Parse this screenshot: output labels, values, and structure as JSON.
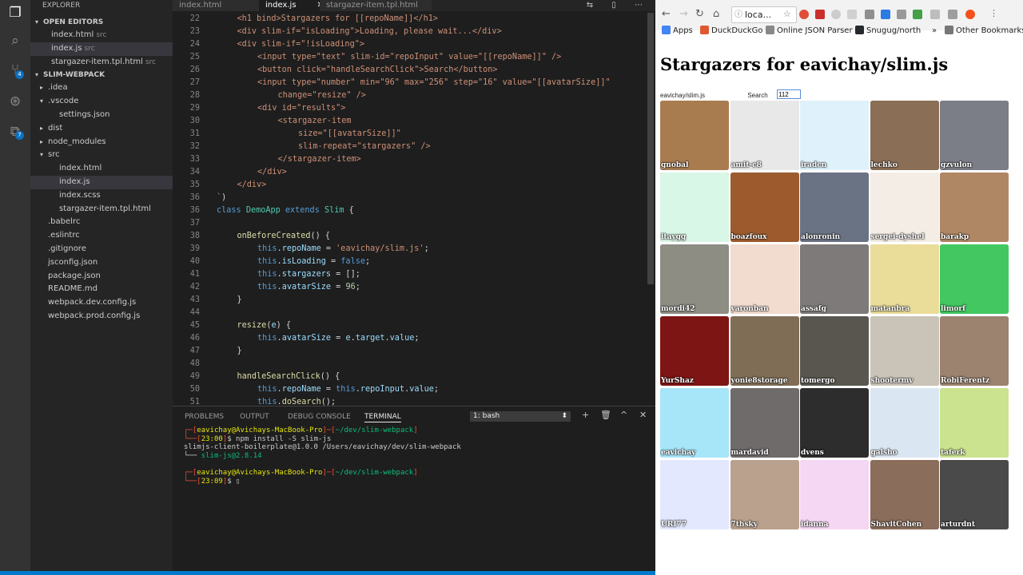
{
  "explorer": {
    "title": "EXPLORER",
    "open_editors_label": "OPEN EDITORS",
    "open_editors": [
      {
        "name": "index.html",
        "folder": "src"
      },
      {
        "name": "index.js",
        "folder": "src"
      },
      {
        "name": "stargazer-item.tpl.html",
        "folder": "src"
      }
    ],
    "project_label": "SLIM-WEBPACK",
    "tree": [
      {
        "name": ".idea",
        "folder": true
      },
      {
        "name": ".vscode",
        "folder": true,
        "open": true
      },
      {
        "name": "settings.json",
        "indent": 2
      },
      {
        "name": "dist",
        "folder": true
      },
      {
        "name": "node_modules",
        "folder": true
      },
      {
        "name": "src",
        "folder": true,
        "open": true
      },
      {
        "name": "index.html",
        "indent": 2
      },
      {
        "name": "index.js",
        "indent": 2,
        "selected": true
      },
      {
        "name": "index.scss",
        "indent": 2
      },
      {
        "name": "stargazer-item.tpl.html",
        "indent": 2
      },
      {
        "name": ".babelrc"
      },
      {
        "name": ".eslintrc"
      },
      {
        "name": ".gitignore"
      },
      {
        "name": "jsconfig.json"
      },
      {
        "name": "package.json"
      },
      {
        "name": "README.md"
      },
      {
        "name": "webpack.dev.config.js"
      },
      {
        "name": "webpack.prod.config.js"
      }
    ]
  },
  "editor": {
    "tabs": [
      "index.html",
      "index.js",
      "stargazer-item.tpl.html"
    ],
    "active_tab": "index.js",
    "close_glyph": "✕",
    "tool_glyphs": "⇆ ▯ ⋯",
    "lines": [
      {
        "n": "22",
        "html": "<span class=\"s\">&lt;h1 bind&gt;Stargazers for [[repoName]]&lt;/h1&gt;</span>",
        "ind": 1
      },
      {
        "n": "23",
        "html": "<span class=\"s\">&lt;div slim-if=\"isLoading\"&gt;Loading, please wait...&lt;/div&gt;</span>",
        "ind": 1
      },
      {
        "n": "24",
        "html": "<span class=\"s\">&lt;div slim-if=\"!isLoading\"&gt;</span>",
        "ind": 1
      },
      {
        "n": "25",
        "html": "<span class=\"s\">&lt;input type=\"text\" slim-id=\"repoInput\" value=\"[[repoName]]\" /&gt;</span>",
        "ind": 2
      },
      {
        "n": "26",
        "html": "<span class=\"s\">&lt;button click=\"handleSearchClick\"&gt;Search&lt;/button&gt;</span>",
        "ind": 2
      },
      {
        "n": "27",
        "html": "<span class=\"s\">&lt;input type=\"number\" min=\"96\" max=\"256\" step=\"16\" value=\"[[avatarSize]]\"</span>",
        "ind": 2
      },
      {
        "n": "28",
        "html": "<span class=\"s\">change=\"resize\" /&gt;</span>",
        "ind": 3
      },
      {
        "n": "29",
        "html": "<span class=\"s\">&lt;div id=\"results\"&gt;</span>",
        "ind": 2
      },
      {
        "n": "30",
        "html": "<span class=\"s\">&lt;stargazer-item</span>",
        "ind": 3
      },
      {
        "n": "31",
        "html": "<span class=\"s\">size=\"[[avatarSize]]\"</span>",
        "ind": 4
      },
      {
        "n": "32",
        "html": "<span class=\"s\">slim-repeat=\"stargazers\" /&gt;</span>",
        "ind": 4
      },
      {
        "n": "33",
        "html": "<span class=\"s\">&lt;/stargazer-item&gt;</span>",
        "ind": 3
      },
      {
        "n": "34",
        "html": "<span class=\"s\">&lt;/div&gt;</span>",
        "ind": 2
      },
      {
        "n": "35",
        "html": "<span class=\"s\">&lt;/div&gt;</span>",
        "ind": 1
      },
      {
        "n": "36",
        "html": "<span class=\"s\">`</span>)",
        "ind": 0
      },
      {
        "n": "36",
        "html": "<span class=\"k\">class</span> <span class=\"t\">DemoApp</span> <span class=\"k\">extends</span> <span class=\"t\">Slim</span> {",
        "ind": 0
      },
      {
        "n": "37",
        "html": "",
        "ind": 0
      },
      {
        "n": "38",
        "html": "<span class=\"f\">onBeforeCreated</span>() {",
        "ind": 1
      },
      {
        "n": "39",
        "html": "<span class=\"k\">this</span>.<span class=\"p\">repoName</span> = <span class=\"s\">'eavichay/slim.js'</span>;",
        "ind": 2
      },
      {
        "n": "40",
        "html": "<span class=\"k\">this</span>.<span class=\"p\">isLoading</span> = <span class=\"k\">false</span>;",
        "ind": 2
      },
      {
        "n": "41",
        "html": "<span class=\"k\">this</span>.<span class=\"p\">stargazers</span> = [];",
        "ind": 2
      },
      {
        "n": "42",
        "html": "<span class=\"k\">this</span>.<span class=\"p\">avatarSize</span> = <span class=\"n\">96</span>;",
        "ind": 2
      },
      {
        "n": "43",
        "html": "}",
        "ind": 1
      },
      {
        "n": "44",
        "html": "",
        "ind": 0
      },
      {
        "n": "45",
        "html": "<span class=\"f\">resize</span>(<span class=\"p\">e</span>) {",
        "ind": 1
      },
      {
        "n": "46",
        "html": "<span class=\"k\">this</span>.<span class=\"p\">avatarSize</span> = <span class=\"p\">e</span>.<span class=\"p\">target</span>.<span class=\"p\">value</span>;",
        "ind": 2
      },
      {
        "n": "47",
        "html": "}",
        "ind": 1
      },
      {
        "n": "48",
        "html": "",
        "ind": 0
      },
      {
        "n": "49",
        "html": "<span class=\"f\">handleSearchClick</span>() {",
        "ind": 1
      },
      {
        "n": "50",
        "html": "<span class=\"k\">this</span>.<span class=\"p\">repoName</span> = <span class=\"k\">this</span>.<span class=\"p\">repoInput</span>.<span class=\"p\">value</span>;",
        "ind": 2
      },
      {
        "n": "51",
        "html": "<span class=\"k\">this</span>.<span class=\"f\">doSearch</span>();",
        "ind": 2
      }
    ]
  },
  "panel": {
    "tabs": [
      "PROBLEMS",
      "OUTPUT",
      "DEBUG CONSOLE",
      "TERMINAL"
    ],
    "active": "TERMINAL",
    "terminal_select": "1: bash",
    "icons": [
      "+",
      "🗑",
      "^",
      "✕"
    ],
    "terminal_lines": [
      "<span class=\"r\">┌─[</span><span class=\"y\">eavichay@Avichays-MacBook-Pro</span><span class=\"r\">]─[</span><span class=\"g\">~/dev/slim-webpack</span><span class=\"r\">]</span>",
      "<span class=\"r\">└──[</span><span class=\"y\">23:00</span><span class=\"r\">]</span>$ npm install -S slim-js",
      "slimjs-client-boilerplate@1.0.0 /Users/eavichay/dev/slim-webpack",
      "└── <span class=\"g\">slim-js@2.8.14</span>",
      "",
      "<span class=\"r\">┌─[</span><span class=\"y\">eavichay@Avichays-MacBook-Pro</span><span class=\"r\">]─[</span><span class=\"g\">~/dev/slim-webpack</span><span class=\"r\">]</span>",
      "<span class=\"r\">└──[</span><span class=\"y\">23:09</span><span class=\"r\">]</span>$ ▯"
    ]
  },
  "browser": {
    "url": "loca...",
    "bookmarks": [
      {
        "label": "Apps",
        "color": "#4285f4"
      },
      {
        "label": "DuckDuckGo",
        "color": "#de5833"
      },
      {
        "label": "Online JSON Parser",
        "color": "#888888"
      },
      {
        "label": "Snugug/north",
        "color": "#24292e"
      },
      {
        "label": "»",
        "color": ""
      },
      {
        "label": "Other Bookmarks",
        "color": "#777777"
      }
    ],
    "page_title": "Stargazers for eavichay/slim.js",
    "repo_value": "eavichay/slim.js",
    "search_label": "Search",
    "size_value": "112",
    "stargazers": [
      {
        "login": "gnobal",
        "color": "#a97c50"
      },
      {
        "login": "amit-c8",
        "color": "#e8e8e8"
      },
      {
        "login": "iradcn",
        "color": "#dff2fb"
      },
      {
        "login": "lechko",
        "color": "#8a6e55"
      },
      {
        "login": "gzvulon",
        "color": "#7b7e86"
      },
      {
        "login": "itaygg",
        "color": "#d9f7e6"
      },
      {
        "login": "boazfoux",
        "color": "#9d5b2d"
      },
      {
        "login": "alonronin",
        "color": "#6a7384"
      },
      {
        "login": "sergei-dyshel",
        "color": "#f3ede6"
      },
      {
        "login": "barakp",
        "color": "#b08765"
      },
      {
        "login": "mordi42",
        "color": "#8d8d84"
      },
      {
        "login": "yaronban",
        "color": "#f2dbcf"
      },
      {
        "login": "assafg",
        "color": "#7d7a79"
      },
      {
        "login": "matanbra",
        "color": "#eadd9a"
      },
      {
        "login": "limorf",
        "color": "#43c761"
      },
      {
        "login": "YurShaz",
        "color": "#7d1515"
      },
      {
        "login": "yonie8storage",
        "color": "#7f6d56"
      },
      {
        "login": "tomergo",
        "color": "#595650"
      },
      {
        "login": "shootermv",
        "color": "#c9c3b8"
      },
      {
        "login": "RobiFerentz",
        "color": "#9b8370"
      },
      {
        "login": "eavichay",
        "color": "#a7e5f9"
      },
      {
        "login": "mardavid",
        "color": "#6f6b6b"
      },
      {
        "login": "dvens",
        "color": "#2d2d2d"
      },
      {
        "login": "galsho",
        "color": "#dae7f2"
      },
      {
        "login": "taferk",
        "color": "#cbe38f"
      },
      {
        "login": "URI77",
        "color": "#e3e8ff"
      },
      {
        "login": "7thsky",
        "color": "#b9a18d"
      },
      {
        "login": "idanna",
        "color": "#f5d7f3"
      },
      {
        "login": "ShavitCohen",
        "color": "#8a6d5a"
      },
      {
        "login": "arturdnt",
        "color": "#4a4a4a"
      }
    ]
  }
}
